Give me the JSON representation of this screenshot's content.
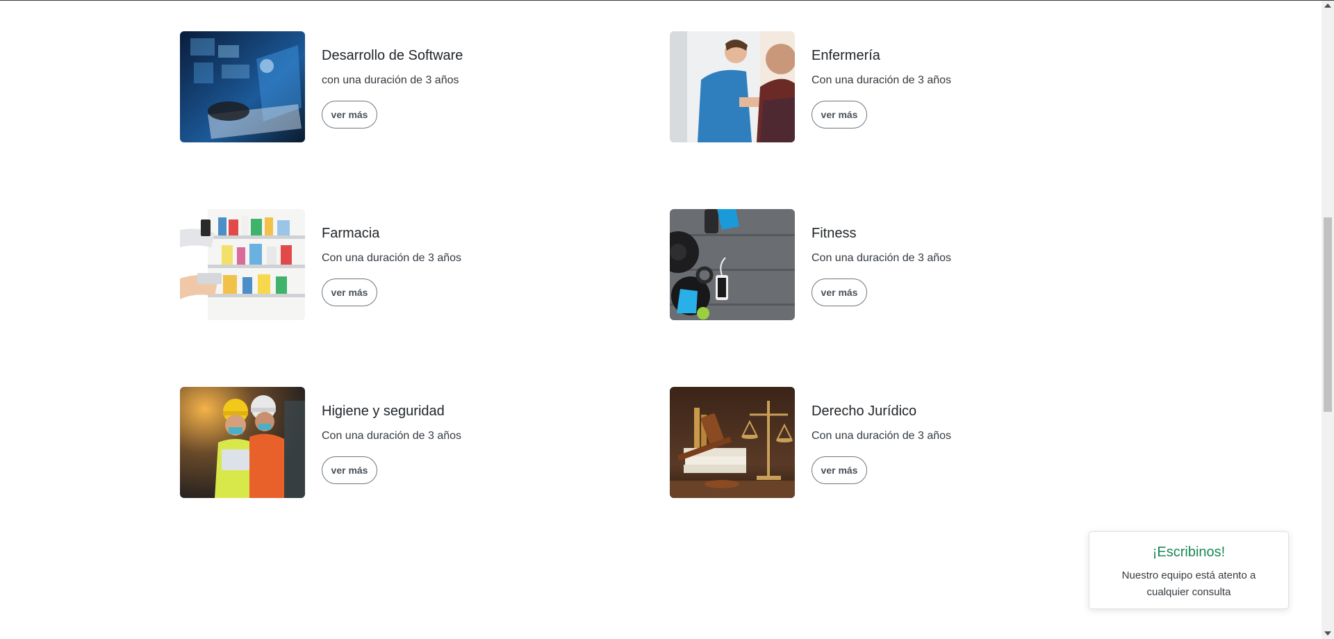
{
  "courses": [
    {
      "title": "Desarrollo de Software",
      "description": "con una duración de 3 años",
      "button": "ver más",
      "image": "software-development-photo"
    },
    {
      "title": "Enfermería",
      "description": "Con una duración de 3 años",
      "button": "ver más",
      "image": "nursing-photo"
    },
    {
      "title": "Farmacia",
      "description": "Con una duración de 3 años",
      "button": "ver más",
      "image": "pharmacy-photo"
    },
    {
      "title": "Fitness",
      "description": "Con una duración de 3 años",
      "button": "ver más",
      "image": "fitness-photo"
    },
    {
      "title": "Higiene y seguridad",
      "description": "Con una duración de 3 años",
      "button": "ver más",
      "image": "safety-photo"
    },
    {
      "title": "Derecho Jurídico",
      "description": "Con una duración de 3 años",
      "button": "ver más",
      "image": "law-photo"
    }
  ],
  "chat": {
    "title": "¡Escribinos!",
    "text": "Nuestro equipo está atento a cualquier consulta"
  },
  "colors": {
    "chat_title": "#198754",
    "button_border": "#6c757d"
  }
}
